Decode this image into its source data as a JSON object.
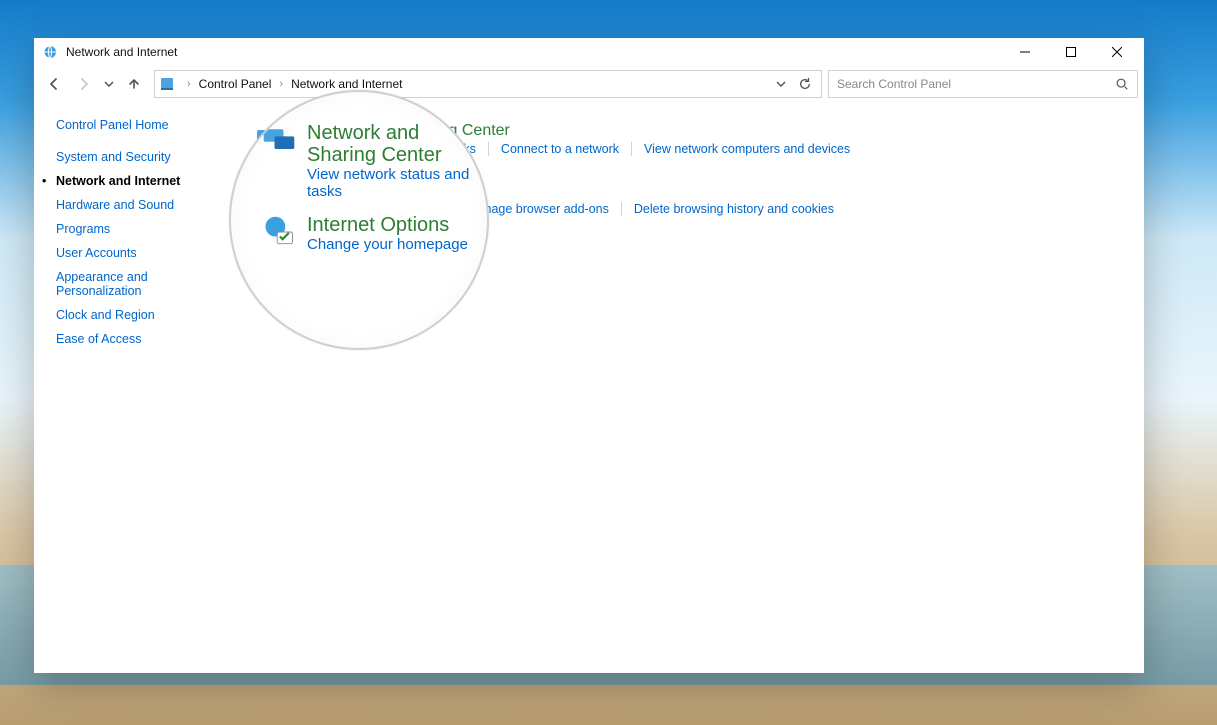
{
  "window": {
    "title": "Network and Internet"
  },
  "breadcrumb": {
    "item0": "Control Panel",
    "item1": "Network and Internet"
  },
  "search": {
    "placeholder": "Search Control Panel"
  },
  "sidebar": {
    "home": "Control Panel Home",
    "items": [
      {
        "label": "System and Security"
      },
      {
        "label": "Network and Internet",
        "active": true
      },
      {
        "label": "Hardware and Sound"
      },
      {
        "label": "Programs"
      },
      {
        "label": "User Accounts"
      },
      {
        "label": "Appearance and Personalization"
      },
      {
        "label": "Clock and Region"
      },
      {
        "label": "Ease of Access"
      }
    ]
  },
  "categories": [
    {
      "title": "Network and Sharing Center",
      "tasks": [
        "View network status and tasks",
        "Connect to a network",
        "View network computers and devices"
      ]
    },
    {
      "title": "Internet Options",
      "tasks": [
        "Change your homepage",
        "Manage browser add-ons",
        "Delete browsing history and cookies"
      ]
    }
  ],
  "magnifier": {
    "row0": {
      "title": "Network and Sharing Center",
      "sub": "View network status and tasks"
    },
    "row1": {
      "title": "Internet Options",
      "sub": "Change your homepage"
    }
  }
}
